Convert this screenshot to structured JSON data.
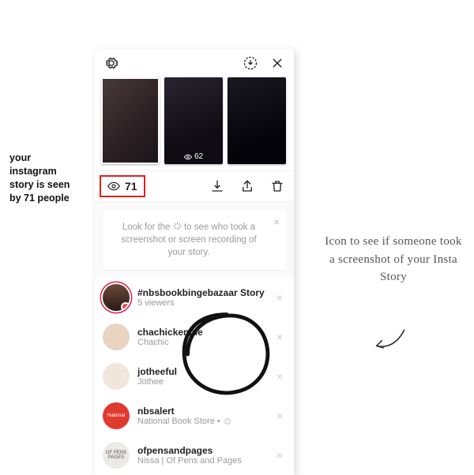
{
  "annotations": {
    "left": "your instagram story is seen by 71 people",
    "right": "Icon to see if someone took a screenshot of your Insta Story"
  },
  "header": {
    "settings_icon": "gear",
    "save_icon": "save-story",
    "close_icon": "close"
  },
  "stories": [
    {
      "label": "",
      "count": "",
      "selected": true,
      "tag": ""
    },
    {
      "label": "",
      "count": "62",
      "selected": false,
      "tag": ""
    },
    {
      "label": "",
      "count": "",
      "selected": false,
      "tag": ""
    }
  ],
  "views": {
    "count": "71"
  },
  "hint": {
    "text_a": "Look for the ",
    "text_b": " to see who took a screenshot or screen recording of your story."
  },
  "viewers": [
    {
      "username": "#nbsbookbingebazaar Story",
      "sub": "5 viewers",
      "avatar_bg": "linear-gradient(#6b4a3a,#2a1a14)",
      "ring": true,
      "badge": true,
      "burst": false
    },
    {
      "username": "chachickenpie",
      "sub": "Chachic",
      "avatar_bg": "#e8d4c0",
      "ring": false,
      "badge": false,
      "burst": false
    },
    {
      "username": "jotheeful",
      "sub": "Jothee",
      "avatar_bg": "#f0e6da",
      "ring": false,
      "badge": false,
      "burst": false
    },
    {
      "username": "nbsalert",
      "sub": "National Book Store • ",
      "avatar_bg": "#e03a2f",
      "avatar_text": "National",
      "ring": false,
      "badge": false,
      "burst": true
    },
    {
      "username": "ofpensandpages",
      "sub": "Nissa | Of Pens and Pages",
      "avatar_bg": "#eceae6",
      "avatar_text": "OF PENS PAGES",
      "ring": false,
      "badge": false,
      "burst": false
    }
  ]
}
